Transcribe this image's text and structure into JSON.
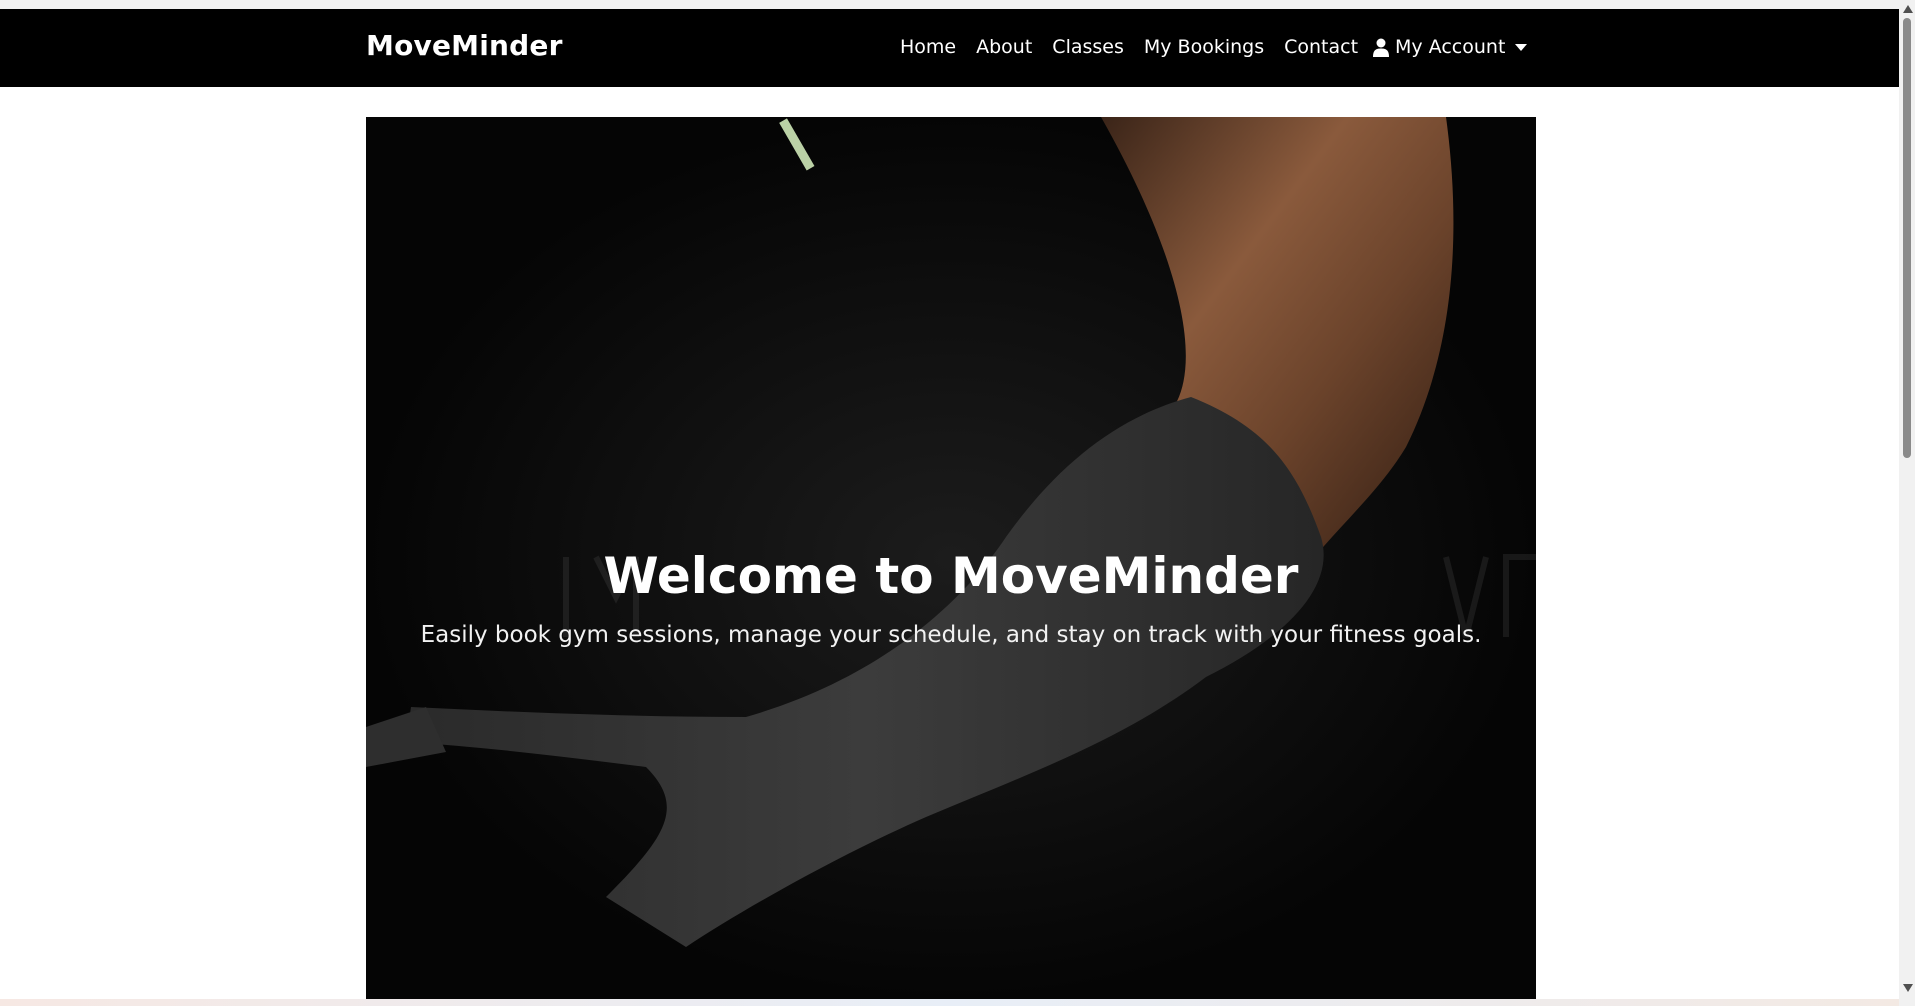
{
  "navbar": {
    "brand": "MoveMinder",
    "links": [
      "Home",
      "About",
      "Classes",
      "My Bookings",
      "Contact"
    ],
    "account_label": "My Account",
    "account_icon": "user-icon",
    "background_color": "#000000"
  },
  "hero": {
    "title": "Welcome to MoveMinder",
    "subtitle": "Easily book gym sessions, manage your schedule, and stay on track with your fitness goals."
  }
}
